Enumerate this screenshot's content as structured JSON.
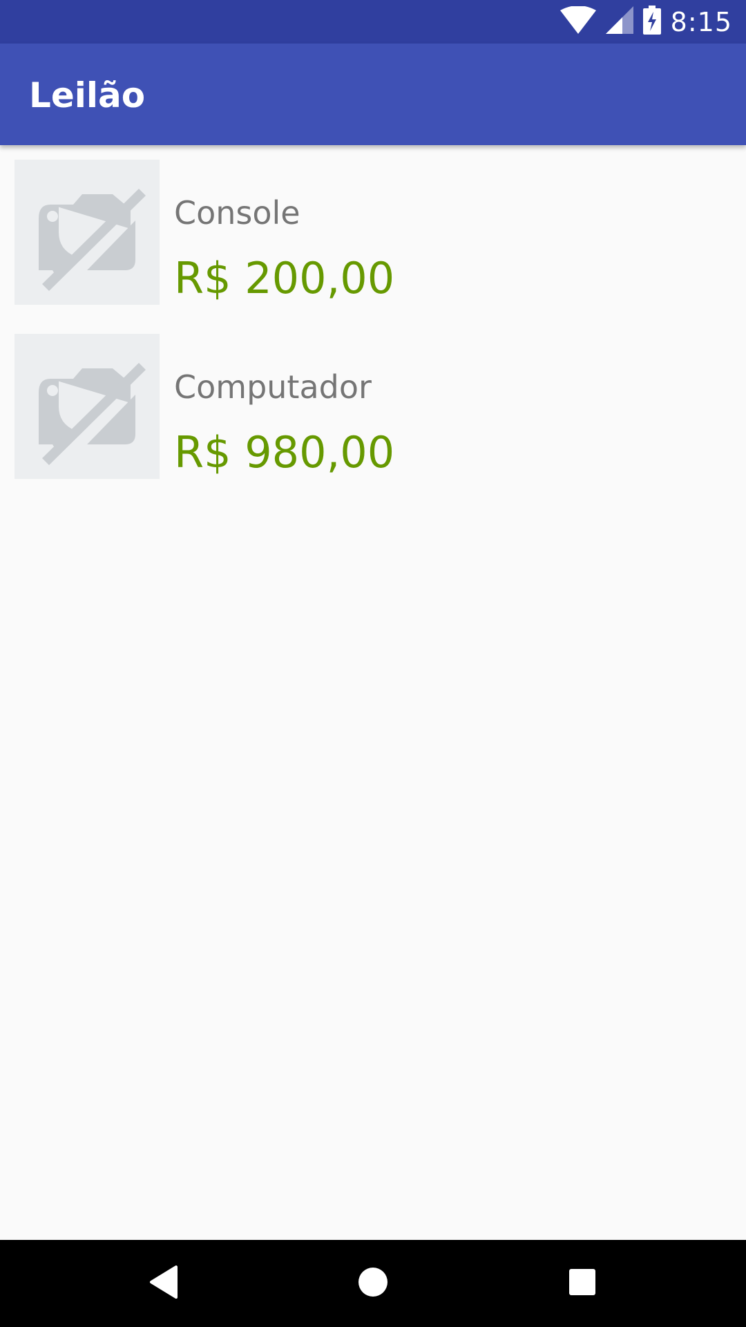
{
  "status_bar": {
    "time": "8:15",
    "icons": [
      "wifi-icon",
      "cell-signal-icon",
      "battery-charging-icon"
    ]
  },
  "app_bar": {
    "title": "Leilão",
    "color": "#3f51b5",
    "status_color": "#303f9f"
  },
  "auctions": [
    {
      "name": "Console",
      "price": "R$ 200,00",
      "image_icon": "image-unavailable-icon"
    },
    {
      "name": "Computador",
      "price": "R$ 980,00",
      "image_icon": "image-unavailable-icon"
    }
  ],
  "price_color": "#669900",
  "nav_bar": {
    "buttons": [
      "back-icon",
      "home-icon",
      "recents-icon"
    ]
  }
}
